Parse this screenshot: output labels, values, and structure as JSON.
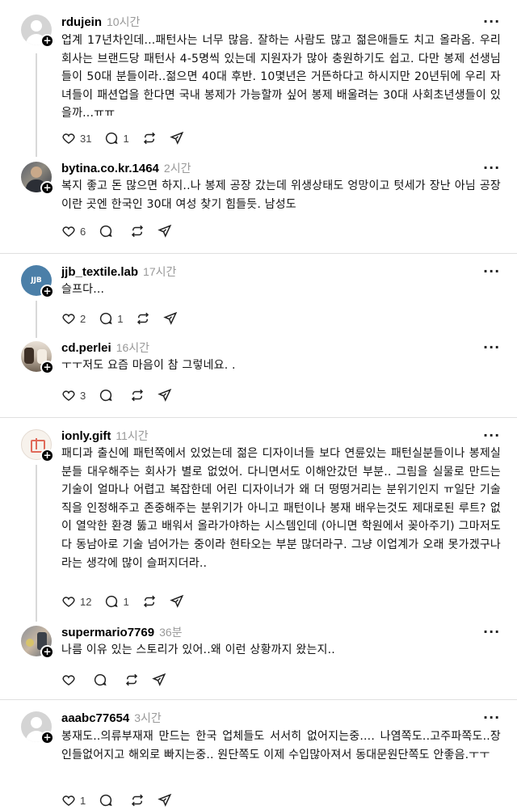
{
  "threads": [
    {
      "posts": [
        {
          "username": "rdujein",
          "time": "10시간",
          "avatar": "default-avatar-icon",
          "text": "업계 17년차인데...패턴사는 너무 많음. 잘하는 사람도 많고 젊은애들도 치고 올라옴. 우리 회사는 브랜드당 패턴사 4-5명씩 있는데 지원자가 많아 충원하기도 쉽고. 다만 봉제 선생님들이 50대 분들이라..젊으면 40대 후반. 10몇년은 거뜬하다고 하시지만 20년뒤에 우리 자녀들이 패션업을 한다면 국내 봉제가 가능할까 싶어 봉제 배울려는 30대 사회초년생들이 있을까...ㅠㅠ",
          "likes": "31",
          "replies": "1"
        },
        {
          "username": "bytina.co.kr.1464",
          "time": "2시간",
          "avatar": "profile-photo",
          "text": "복지 좋고 돈 많으면 하지..나 봉제 공장 갔는데 위생상태도 엉망이고 텃세가 장난 아님 공장이란 곳엔 한국인 30대 여성 찾기 힘들듯. 남성도",
          "likes": "6",
          "replies": ""
        }
      ]
    },
    {
      "posts": [
        {
          "username": "jjb_textile.lab",
          "time": "17시간",
          "avatar": "brand-logo",
          "avatar_text": "JJB",
          "text": "슬프다...",
          "likes": "2",
          "replies": "1"
        },
        {
          "username": "cd.perlei",
          "time": "16시간",
          "avatar": "profile-photo",
          "text": "ㅜㅜ저도 요즘 마음이 참 그렇네요. .",
          "likes": "3",
          "replies": ""
        }
      ]
    },
    {
      "posts": [
        {
          "username": "ionly.gift",
          "time": "11시간",
          "avatar": "gift-logo",
          "text": "패디과 출신에 패턴쪽에서 있었는데 젊은 디자이너들 보다 연륜있는 패턴실분들이나 봉제실 분들 대우해주는 회사가 별로 없었어. 다니면서도 이해안갔던 부분.. 그림을 실물로 만드는 기술이 얼마나 어렵고 복잡한데 어린 디자이너가 왜 더 떵떵거리는 분위기인지 ㅠ일단 기술직을 인정해주고 존중해주는 분위기가 아니고 패턴이나 봉재 배우는것도 제대로된 루트? 없이 열악한 환경 뚫고 배워서 올라가야하는 시스템인데 (아니면 학원에서 꽂아주기) 그마저도 다 동남아로 기술 넘어가는 중이라 현타오는 부분 많더라구. 그냥 이업계가 오래 못가겠구나 라는 생각에 많이 슬퍼지더라..",
          "likes": "12",
          "replies": "1"
        },
        {
          "username": "supermario7769",
          "time": "36분",
          "avatar": "profile-photo",
          "text": "나름 이유 있는 스토리가 있어..왜 이런 상황까지 왔는지..",
          "likes": "",
          "replies": ""
        }
      ]
    },
    {
      "posts": [
        {
          "username": "aaabc77654",
          "time": "3시간",
          "avatar": "default-avatar-icon",
          "text": "봉재도..의류부재재 만드는 한국 업체들도 서서히 없어지는중.... 나염쪽도..고주파쪽도..장인들없어지고 해외로 빠지는중.. 원단쪽도 이제 수입많아져서 동대문원단쪽도 안좋음.ㅜㅜ",
          "likes": "1",
          "replies": ""
        }
      ]
    }
  ],
  "icons": {
    "like": "heart-icon",
    "reply": "comment-icon",
    "repost": "repost-icon",
    "share": "send-icon",
    "more": "more-icon",
    "follow": "plus-icon"
  }
}
